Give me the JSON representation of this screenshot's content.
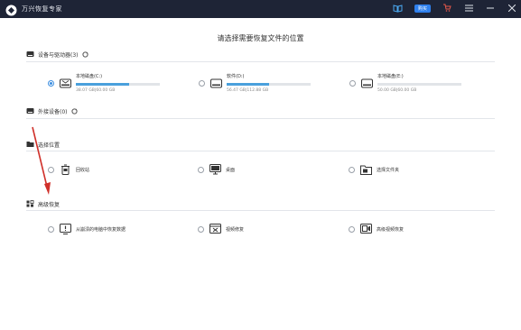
{
  "window": {
    "title": "万兴恢复专家",
    "vip_label": "购买"
  },
  "page": {
    "title": "请选择需要恢复文件的位置"
  },
  "sections": {
    "devices": {
      "title": "设备与驱动器(3)"
    },
    "external": {
      "title": "外接设备(0)"
    },
    "location": {
      "title": "选择位置"
    },
    "advanced": {
      "title": "高级恢复"
    }
  },
  "drives": [
    {
      "name": "本地磁盘(C:)",
      "size": "38.07 GB|60.00 GB",
      "used_fraction": 0.63,
      "selected": true
    },
    {
      "name": "软件(D:)",
      "size": "56.47 GB|112.88 GB",
      "used_fraction": 0.5,
      "selected": false
    },
    {
      "name": "本地磁盘(E:)",
      "size": "50.00 GB|60.00 GB",
      "used_fraction": 0.0,
      "selected": false
    }
  ],
  "locations": [
    {
      "label": "回收站",
      "icon": "recycle-bin-icon"
    },
    {
      "label": "桌面",
      "icon": "desktop-icon"
    },
    {
      "label": "选择文件夹",
      "icon": "folder-icon"
    }
  ],
  "advanced": [
    {
      "label": "从崩溃的电脑中恢复数据",
      "icon": "crash-recovery-icon"
    },
    {
      "label": "视频修复",
      "icon": "video-repair-icon"
    },
    {
      "label": "高级视频恢复",
      "icon": "advanced-video-icon"
    }
  ],
  "colors": {
    "titlebar": "#1e2436",
    "accent": "#3b8de0",
    "annotation_arrow": "#d0302a"
  }
}
